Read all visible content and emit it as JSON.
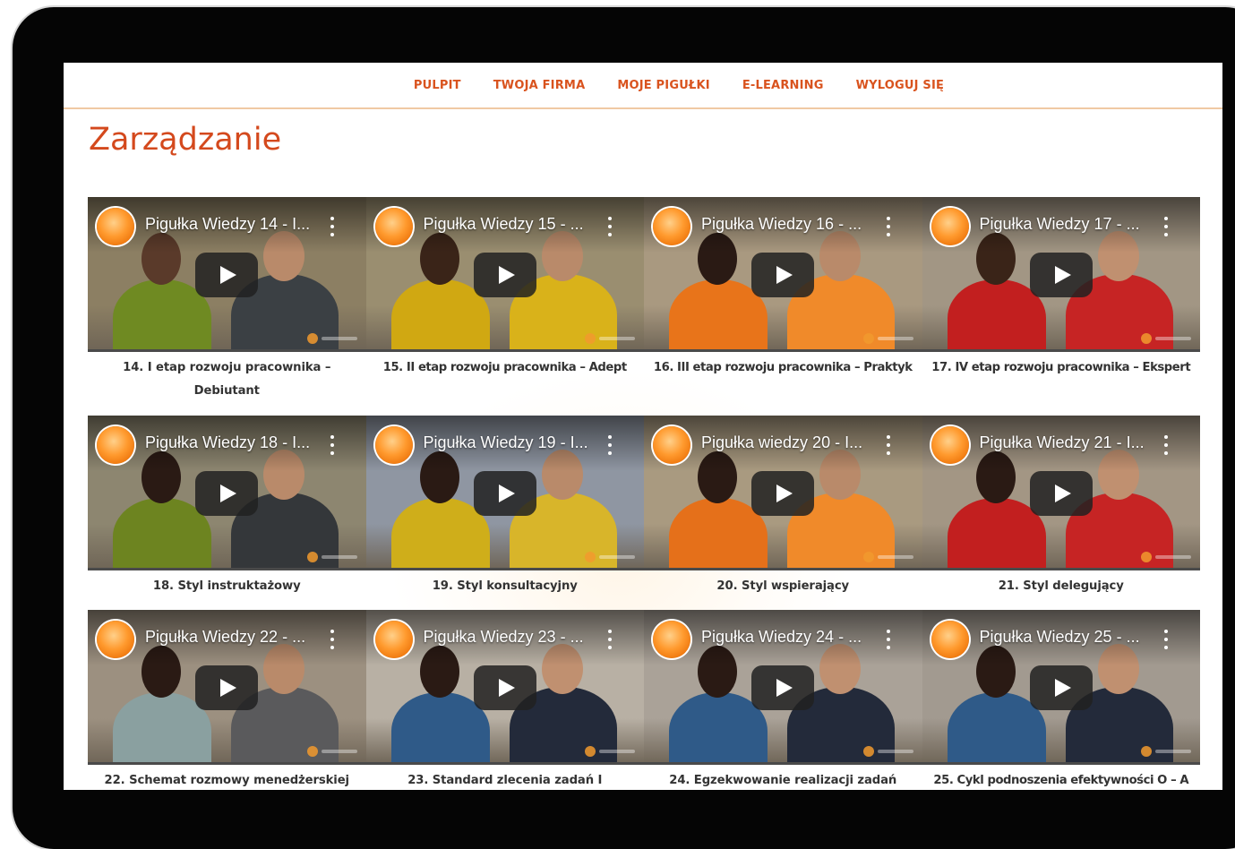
{
  "nav": {
    "items": [
      {
        "label": "PULPIT"
      },
      {
        "label": "TWOJA FIRMA"
      },
      {
        "label": "MOJE PIGUŁKI"
      },
      {
        "label": "E-LEARNING"
      },
      {
        "label": "WYLOGUJ SIĘ"
      }
    ]
  },
  "page": {
    "title": "Zarządzanie"
  },
  "colors": {
    "accent": "#d4491d",
    "nav_border": "#f0c9a4",
    "device_frame": "#050505",
    "channel_logo": "#ff9a2e"
  },
  "icons": {
    "play": "youtube-play-icon",
    "channel": "channel-logo-icon",
    "menu": "kebab-menu-icon"
  },
  "videos": [
    {
      "title": "Pigułka Wiedzy 14 - I...",
      "caption": "14. I etap rozwoju pracownika – Debiutant",
      "theme": {
        "bg": "#8c7f63",
        "p1": "#6f8a22",
        "p2": "#3b4044",
        "h1": "#5a3a2a",
        "h2": "#b98a6a"
      }
    },
    {
      "title": "Pigułka Wiedzy 15 - ...",
      "caption": "15. II etap rozwoju pracownika – Adept",
      "theme": {
        "bg": "#9a8e70",
        "p1": "#d0a812",
        "p2": "#d9b21a",
        "h1": "#3a2418",
        "h2": "#b98a6a"
      }
    },
    {
      "title": "Pigułka Wiedzy 16 - ...",
      "caption": "16. III etap rozwoju pracownika – Praktyk",
      "theme": {
        "bg": "#a99980",
        "p1": "#e8741a",
        "p2": "#f08a2a",
        "h1": "#2a1a14",
        "h2": "#b98a6a"
      }
    },
    {
      "title": "Pigułka Wiedzy 17 - ...",
      "caption": "17. IV etap rozwoju pracownika – Ekspert",
      "theme": {
        "bg": "#a29684",
        "p1": "#c21f1f",
        "p2": "#c62424",
        "h1": "#3a2418",
        "h2": "#c09070"
      }
    },
    {
      "title": "Pigułka Wiedzy 18 - I...",
      "caption": "18. Styl instruktażowy",
      "theme": {
        "bg": "#8d8670",
        "p1": "#6d8420",
        "p2": "#34373a",
        "h1": "#2a1a14",
        "h2": "#b98a6a"
      }
    },
    {
      "title": "Pigułka Wiedzy 19 - I...",
      "caption": "19. Styl konsultacyjny",
      "theme": {
        "bg": "#8f96a2",
        "p1": "#cfae1a",
        "p2": "#d8b52a",
        "h1": "#2a1a14",
        "h2": "#b98a6a"
      }
    },
    {
      "title": "Pigułka wiedzy 20 - I...",
      "caption": "20. Styl wspierający",
      "theme": {
        "bg": "#a99a80",
        "p1": "#e5701a",
        "p2": "#f08a2a",
        "h1": "#2a1a14",
        "h2": "#b98a6a"
      }
    },
    {
      "title": "Pigułka Wiedzy 21 - I...",
      "caption": "21. Styl delegujący",
      "theme": {
        "bg": "#a39684",
        "p1": "#c21f1f",
        "p2": "#c62424",
        "h1": "#2a1a14",
        "h2": "#c09070"
      }
    },
    {
      "title": "Pigułka Wiedzy 22 - ...",
      "caption": "22. Schemat rozmowy menedżerskiej",
      "theme": {
        "bg": "#9c9080",
        "p1": "#8aa0a0",
        "p2": "#5a5a5c",
        "h1": "#2a1a14",
        "h2": "#b98a6a"
      }
    },
    {
      "title": "Pigułka Wiedzy 23 - ...",
      "caption": "23. Standard zlecenia zadań  I",
      "theme": {
        "bg": "#b8b0a4",
        "p1": "#2f5a88",
        "p2": "#232a3a",
        "h1": "#2a1a14",
        "h2": "#c09070"
      }
    },
    {
      "title": "Pigułka Wiedzy 24 - ...",
      "caption": "24. Egzekwowanie realizacji zadań",
      "theme": {
        "bg": "#aaa298",
        "p1": "#2f5a88",
        "p2": "#232a3a",
        "h1": "#2a1a14",
        "h2": "#c09070"
      }
    },
    {
      "title": "Pigułka Wiedzy 25 - ...",
      "caption": "25. Cykl podnoszenia efektywności O – A",
      "theme": {
        "bg": "#a29a90",
        "p1": "#2f5a88",
        "p2": "#232a3a",
        "h1": "#2a1a14",
        "h2": "#c09070"
      }
    }
  ]
}
